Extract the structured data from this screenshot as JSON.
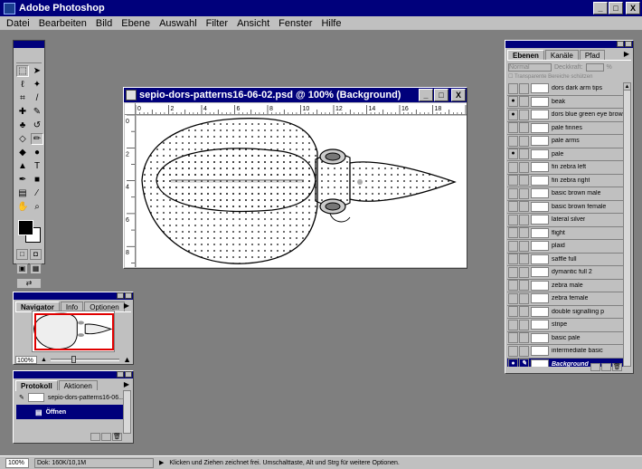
{
  "app": {
    "title": "Adobe Photoshop",
    "min": "_",
    "max": "□",
    "close": "X"
  },
  "menu": [
    "Datei",
    "Bearbeiten",
    "Bild",
    "Ebene",
    "Auswahl",
    "Filter",
    "Ansicht",
    "Fenster",
    "Hilfe"
  ],
  "document": {
    "title": "sepio-dors-patterns16-06-02.psd @ 100% (Background)",
    "ruler_h": [
      "0",
      "2",
      "4",
      "6",
      "8",
      "10",
      "12",
      "14",
      "16",
      "18",
      "20"
    ],
    "ruler_v": [
      "0",
      "2",
      "4",
      "6",
      "8"
    ]
  },
  "navigator": {
    "tabs": [
      "Navigator",
      "Info",
      "Optionen"
    ],
    "zoom": "100%"
  },
  "history": {
    "tabs": [
      "Protokoll",
      "Aktionen"
    ],
    "snapshot": "sepio-dors-patterns16-06...",
    "step": "Öffnen"
  },
  "layers": {
    "tabs": [
      "Ebenen",
      "Kanäle",
      "Pfad"
    ],
    "mode": "Normal",
    "opacity_label": "Deckkraft:",
    "opacity_unit": "%",
    "lock_label": "Transparente Bereiche schützen",
    "items": [
      {
        "name": "dors dark arm tips",
        "visible": false
      },
      {
        "name": "beak",
        "visible": true
      },
      {
        "name": "dors blue green eye brows",
        "visible": true
      },
      {
        "name": "pale finnes",
        "visible": false
      },
      {
        "name": "pale arms",
        "visible": false
      },
      {
        "name": "pale",
        "visible": true
      },
      {
        "name": "fin zebra left",
        "visible": false
      },
      {
        "name": "fin zebra right",
        "visible": false
      },
      {
        "name": "basic brown male",
        "visible": false
      },
      {
        "name": "basic brown female",
        "visible": false
      },
      {
        "name": "lateral silver",
        "visible": false
      },
      {
        "name": "flight",
        "visible": false
      },
      {
        "name": "plaid",
        "visible": false
      },
      {
        "name": "saffle full",
        "visible": false
      },
      {
        "name": "dymantic full 2",
        "visible": false
      },
      {
        "name": "zebra male",
        "visible": false
      },
      {
        "name": "zebra female",
        "visible": false
      },
      {
        "name": "double signalling p",
        "visible": false
      },
      {
        "name": "stripe",
        "visible": false
      },
      {
        "name": "basic pale",
        "visible": false
      },
      {
        "name": "intermediate basic",
        "visible": false
      },
      {
        "name": "Background",
        "visible": true,
        "selected": true
      }
    ]
  },
  "status": {
    "zoom": "100%",
    "doc": "Dok: 160K/10,1M",
    "hint": "Klicken und Ziehen zeichnet frei. Umschalttaste, Alt und Strg für weitere Optionen."
  },
  "icons": {
    "eye": "●",
    "brush": "✎"
  },
  "colors": {
    "titlebar": "#00007b",
    "chrome": "#c0c0c0",
    "workspace": "#7f7f7f",
    "nav_frame": "#e00000"
  }
}
